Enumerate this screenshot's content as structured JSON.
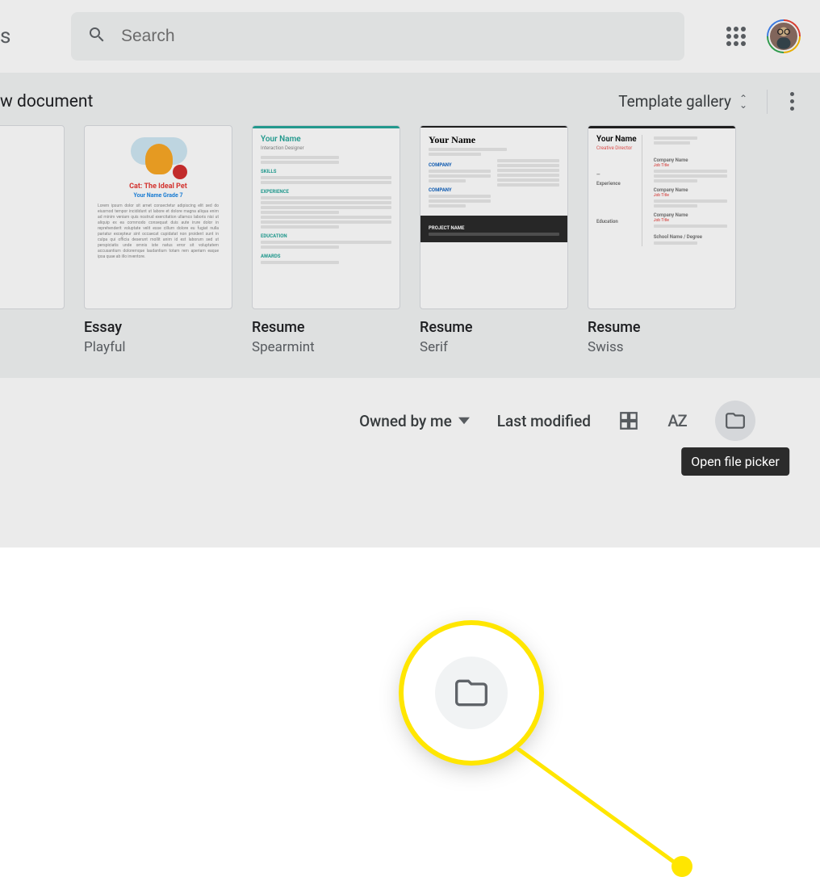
{
  "header": {
    "search_placeholder": "Search"
  },
  "section": {
    "title_fragment": "w document",
    "template_gallery_label": "Template gallery"
  },
  "templates": [
    {
      "title": "Essay",
      "subtitle": "Playful",
      "essay_title": "Cat: The Ideal Pet",
      "essay_sub": "Your Name\nGrade 7"
    },
    {
      "title": "Resume",
      "subtitle": "Spearmint",
      "name": "Your Name",
      "role": "Interaction Designer"
    },
    {
      "title": "Resume",
      "subtitle": "Serif",
      "name": "Your Name"
    },
    {
      "title": "Resume",
      "subtitle": "Swiss",
      "name": "Your Name",
      "role": "Creative Director"
    }
  ],
  "toolbar": {
    "owner_filter": "Owned by me",
    "sort_label": "Last modified",
    "az_label": "AZ",
    "tooltip": "Open file picker"
  }
}
